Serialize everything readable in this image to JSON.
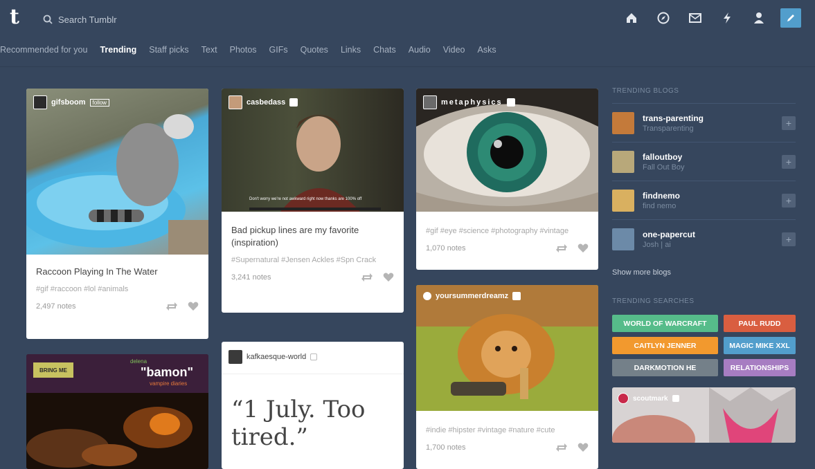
{
  "search": {
    "placeholder": "Search Tumblr"
  },
  "nav_icons": [
    "home-icon",
    "explore-icon",
    "inbox-icon",
    "activity-icon",
    "account-icon",
    "compose-icon"
  ],
  "subnav": [
    "Recommended for you",
    "Trending",
    "Staff picks",
    "Text",
    "Photos",
    "GIFs",
    "Quotes",
    "Links",
    "Chats",
    "Audio",
    "Video",
    "Asks"
  ],
  "subnav_active": "Trending",
  "posts": {
    "raccoon": {
      "author": "gifsboom",
      "author_badge": "follow",
      "caption": "Raccoon Playing In The Water",
      "tags": "#gif  #raccoon  #lol  #animals",
      "notes": "2,497 notes"
    },
    "casbedass": {
      "author": "casbedass",
      "gif_caption": "Don't worry we're not awkward right now thanks are 100% off",
      "caption": "Bad pickup lines are my favorite (inspiration)",
      "tags": "#Supernatural  #Jensen Ackles  #Spn Crack",
      "notes": "3,241 notes"
    },
    "metaphysics": {
      "author": "metaphysics",
      "tags": "#gif  #eye  #science  #photography  #vintage",
      "notes": "1,070 notes"
    },
    "bamon": {
      "logo_text": "BRING ME",
      "overlay_top": "delena",
      "overlay_title": "\"bamon\"",
      "overlay_sub": "vampire diaries"
    },
    "kafkaesque": {
      "author": "kafkaesque-world",
      "quote": "“1 July. Too tired.”"
    },
    "lion": {
      "author": "yoursummerdreamz",
      "tags": "#indie  #hipster  #vintage  #nature  #cute",
      "notes": "1,700 notes"
    }
  },
  "sidebar": {
    "trending_blogs_title": "TRENDING BLOGS",
    "blogs": [
      {
        "name": "trans-parenting",
        "sub": "Transparenting",
        "color": "#c47a3a"
      },
      {
        "name": "falloutboy",
        "sub": "Fall Out Boy",
        "color": "#b8a87a"
      },
      {
        "name": "findnemo",
        "sub": "find nemo",
        "color": "#d9b060"
      },
      {
        "name": "one-papercut",
        "sub": "Josh | ai",
        "color": "#6c8aa8"
      }
    ],
    "show_more": "Show more blogs",
    "trending_searches_title": "TRENDING SEARCHES",
    "searches": [
      {
        "label": "WORLD OF WARCRAFT",
        "color": "#56bc8a"
      },
      {
        "label": "PAUL RUDD",
        "color": "#d95e40"
      },
      {
        "label": "CAITLYN JENNER",
        "color": "#f2992e"
      },
      {
        "label": "MAGIC MIKE XXL",
        "color": "#529ecc"
      },
      {
        "label": "DARKMOTION HE",
        "color": "#748089"
      },
      {
        "label": "RELATIONSHIPS",
        "color": "#a77dc2"
      }
    ],
    "ad_author": "scoutmark"
  }
}
